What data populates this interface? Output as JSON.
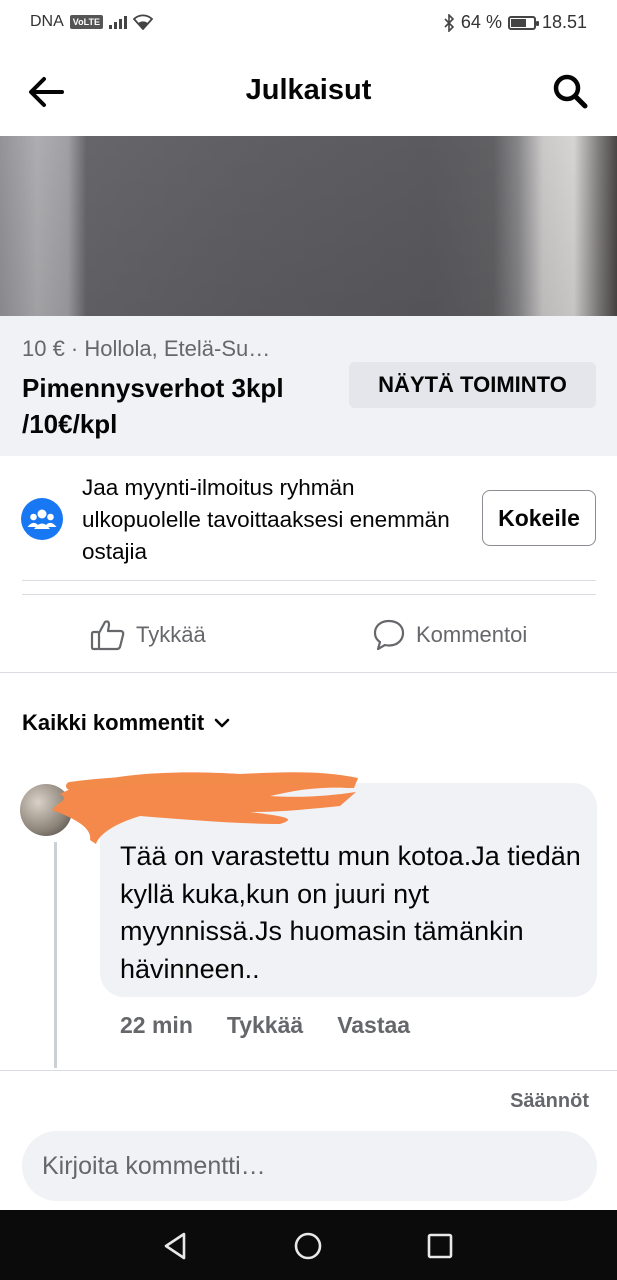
{
  "status_bar": {
    "carrier": "DNA",
    "volte": "VoLTE",
    "battery_percent": "64 %",
    "battery_level": 0.64,
    "time": "18.51"
  },
  "header": {
    "title": "Julkaisut"
  },
  "listing": {
    "price_location": "10 € · Hollola, Etelä-Su…",
    "title": "Pimennysverhot 3kpl /10€/kpl",
    "action_label": "NÄYTÄ TOIMINTO"
  },
  "promo": {
    "text": "Jaa myynti-ilmoitus ryhmän ulkopuolelle tavoittaaksesi enemmän ostajia",
    "button_label": "Kokeile"
  },
  "actions": {
    "like_label": "Tykkää",
    "comment_label": "Kommentoi"
  },
  "comments": {
    "filter_label": "Kaikki kommentit",
    "items": [
      {
        "text": "Tää on varastettu mun kotoa.Ja tiedän kyllä kuka,kun on juuri nyt myynnissä.Js huomasin tämänkin hävinneen..",
        "time": "22 min",
        "like_label": "Tykkää",
        "reply_label": "Vastaa"
      }
    ],
    "rules_label": "Säännöt",
    "input_placeholder": "Kirjoita kommentti…"
  },
  "colors": {
    "secondary_text": "#65676b",
    "surface": "#f0f2f5",
    "promo_icon": "#1877f2",
    "redaction": "#f5894b"
  },
  "icons": [
    "back-arrow-icon",
    "search-icon",
    "group-icon",
    "thumbs-up-icon",
    "comment-icon",
    "chevron-down-icon",
    "nav-back-icon",
    "nav-home-icon",
    "nav-recents-icon",
    "wifi-icon",
    "bluetooth-icon",
    "battery-icon",
    "signal-icon"
  ]
}
